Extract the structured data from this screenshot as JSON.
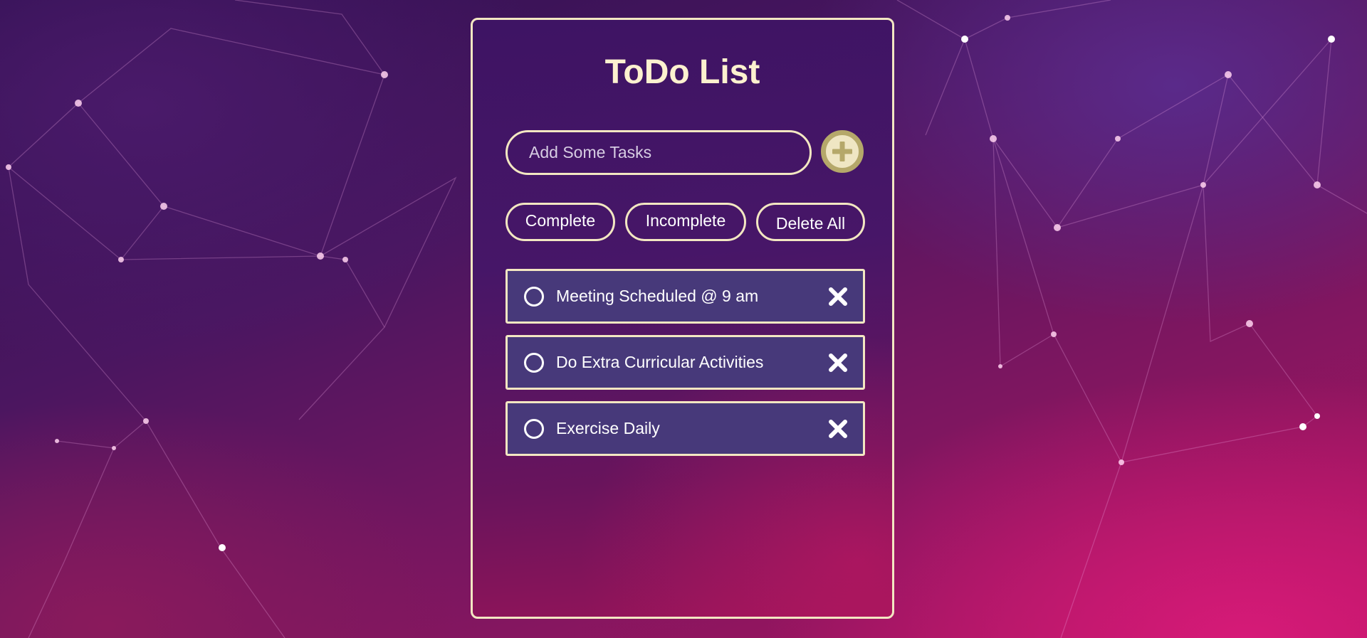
{
  "app": {
    "title": "ToDo List"
  },
  "input": {
    "placeholder": "Add Some Tasks",
    "value": ""
  },
  "add_button": {
    "icon": "plus-icon"
  },
  "filters": {
    "complete_label": "Complete",
    "incomplete_label": "Incomplete",
    "delete_all_label": "Delete All"
  },
  "tasks": [
    {
      "text": "Meeting Scheduled @ 9 am",
      "completed": false
    },
    {
      "text": "Do Extra Curricular Activities",
      "completed": false
    },
    {
      "text": "Exercise Daily",
      "completed": false
    }
  ],
  "colors": {
    "accent": "#f3e7c2",
    "task_bg": "#47397a",
    "add_button_ring": "#b5a86a"
  }
}
